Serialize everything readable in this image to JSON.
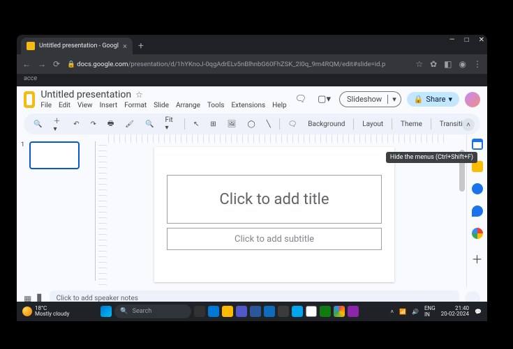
{
  "browser": {
    "tab_title": "Untitled presentation - Googl",
    "url_host": "docs.google.com",
    "url_path": "/presentation/d/1hYKnoJ-0qgAdrELv5nBlhnbG60FhZSK_2I0q_9m4RQM/edit#slide=id.p",
    "bookmark": "acce"
  },
  "doc": {
    "title": "Untitled presentation",
    "menus": [
      "File",
      "Edit",
      "View",
      "Insert",
      "Format",
      "Slide",
      "Arrange",
      "Tools",
      "Extensions",
      "Help"
    ]
  },
  "header": {
    "slideshow": "Slideshow",
    "share": "Share"
  },
  "toolbar": {
    "zoom": "Fit",
    "background": "Background",
    "layout": "Layout",
    "theme": "Theme",
    "transition": "Transition"
  },
  "tooltip": "Hide the menus (Ctrl+Shift+F)",
  "filmstrip": {
    "num1": "1"
  },
  "slide": {
    "title_placeholder": "Click to add title",
    "subtitle_placeholder": "Click to add subtitle"
  },
  "notes": {
    "placeholder": "Click to add speaker notes"
  },
  "taskbar": {
    "temp": "18°C",
    "cond": "Mostly cloudy",
    "search": "Search",
    "lang1": "ENG",
    "lang2": "IN",
    "time": "21:40",
    "date": "20-02-2024"
  }
}
